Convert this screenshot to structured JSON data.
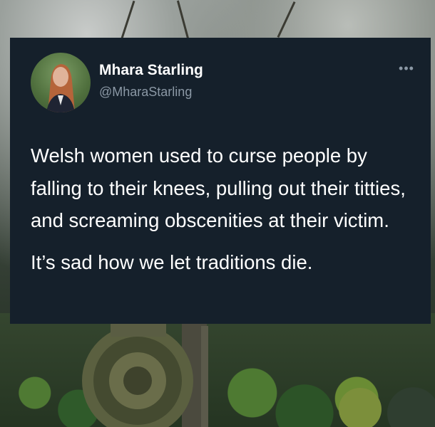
{
  "tweet": {
    "display_name": "Mhara Starling",
    "handle": "@MharaStarling",
    "more_icon": "more-icon",
    "paragraphs": [
      "Welsh women used to curse people by falling to their knees, pulling out their titties, and screaming obscenities at their victim.",
      "It’s sad how we let traditions die."
    ],
    "more_label": "•••"
  },
  "colors": {
    "card_background": "#15202b",
    "text": "#ffffff",
    "secondary_text": "#8b98a5"
  }
}
